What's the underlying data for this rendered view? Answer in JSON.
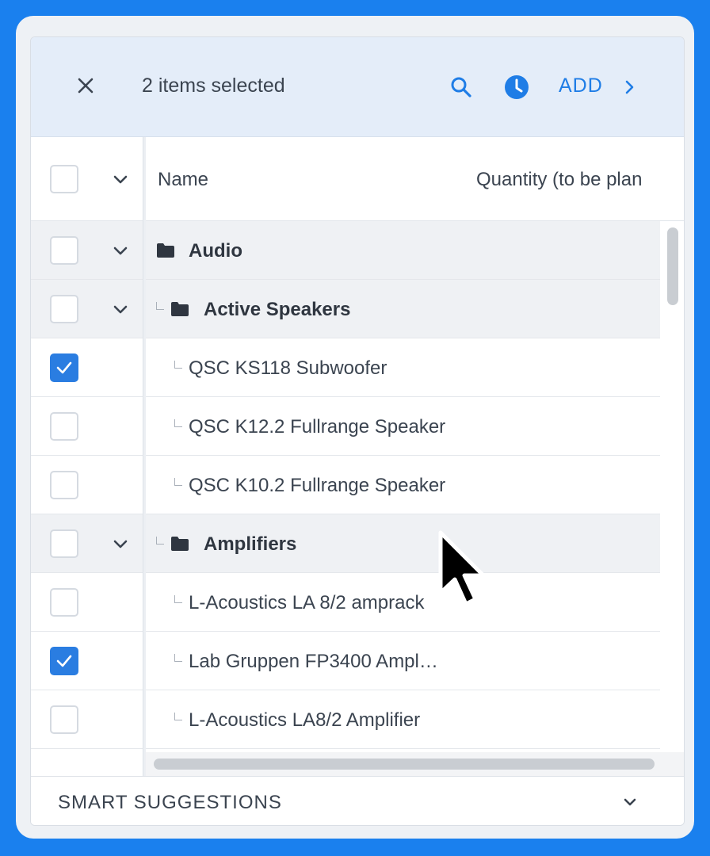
{
  "header": {
    "selection_text": "2 items selected",
    "add_label": "ADD"
  },
  "table": {
    "columns": [
      "Name",
      "Quantity (to be plan"
    ],
    "rows": [
      {
        "label": "Audio",
        "type": "group",
        "checked": false,
        "depth": 0
      },
      {
        "label": "Active Speakers",
        "type": "group",
        "checked": false,
        "depth": 1
      },
      {
        "label": "QSC KS118 Subwoofer",
        "type": "item",
        "checked": true,
        "depth": 2
      },
      {
        "label": "QSC K12.2 Fullrange Speaker",
        "type": "item",
        "checked": false,
        "depth": 2
      },
      {
        "label": "QSC K10.2 Fullrange Speaker",
        "type": "item",
        "checked": false,
        "depth": 2
      },
      {
        "label": "Amplifiers",
        "type": "group",
        "checked": false,
        "depth": 1
      },
      {
        "label": "L-Acoustics LA 8/2 amprack",
        "type": "item",
        "checked": false,
        "depth": 2
      },
      {
        "label": "Lab Gruppen FP3400 Ampl…",
        "type": "item",
        "checked": true,
        "depth": 2
      },
      {
        "label": "L-Acoustics LA8/2 Amplifier",
        "type": "item",
        "checked": false,
        "depth": 2
      }
    ]
  },
  "footer": {
    "label": "SMART SUGGESTIONS"
  },
  "colors": {
    "background": "#1a80ee",
    "accent": "#1f7de6",
    "checkbox_checked": "#2a7de1"
  }
}
